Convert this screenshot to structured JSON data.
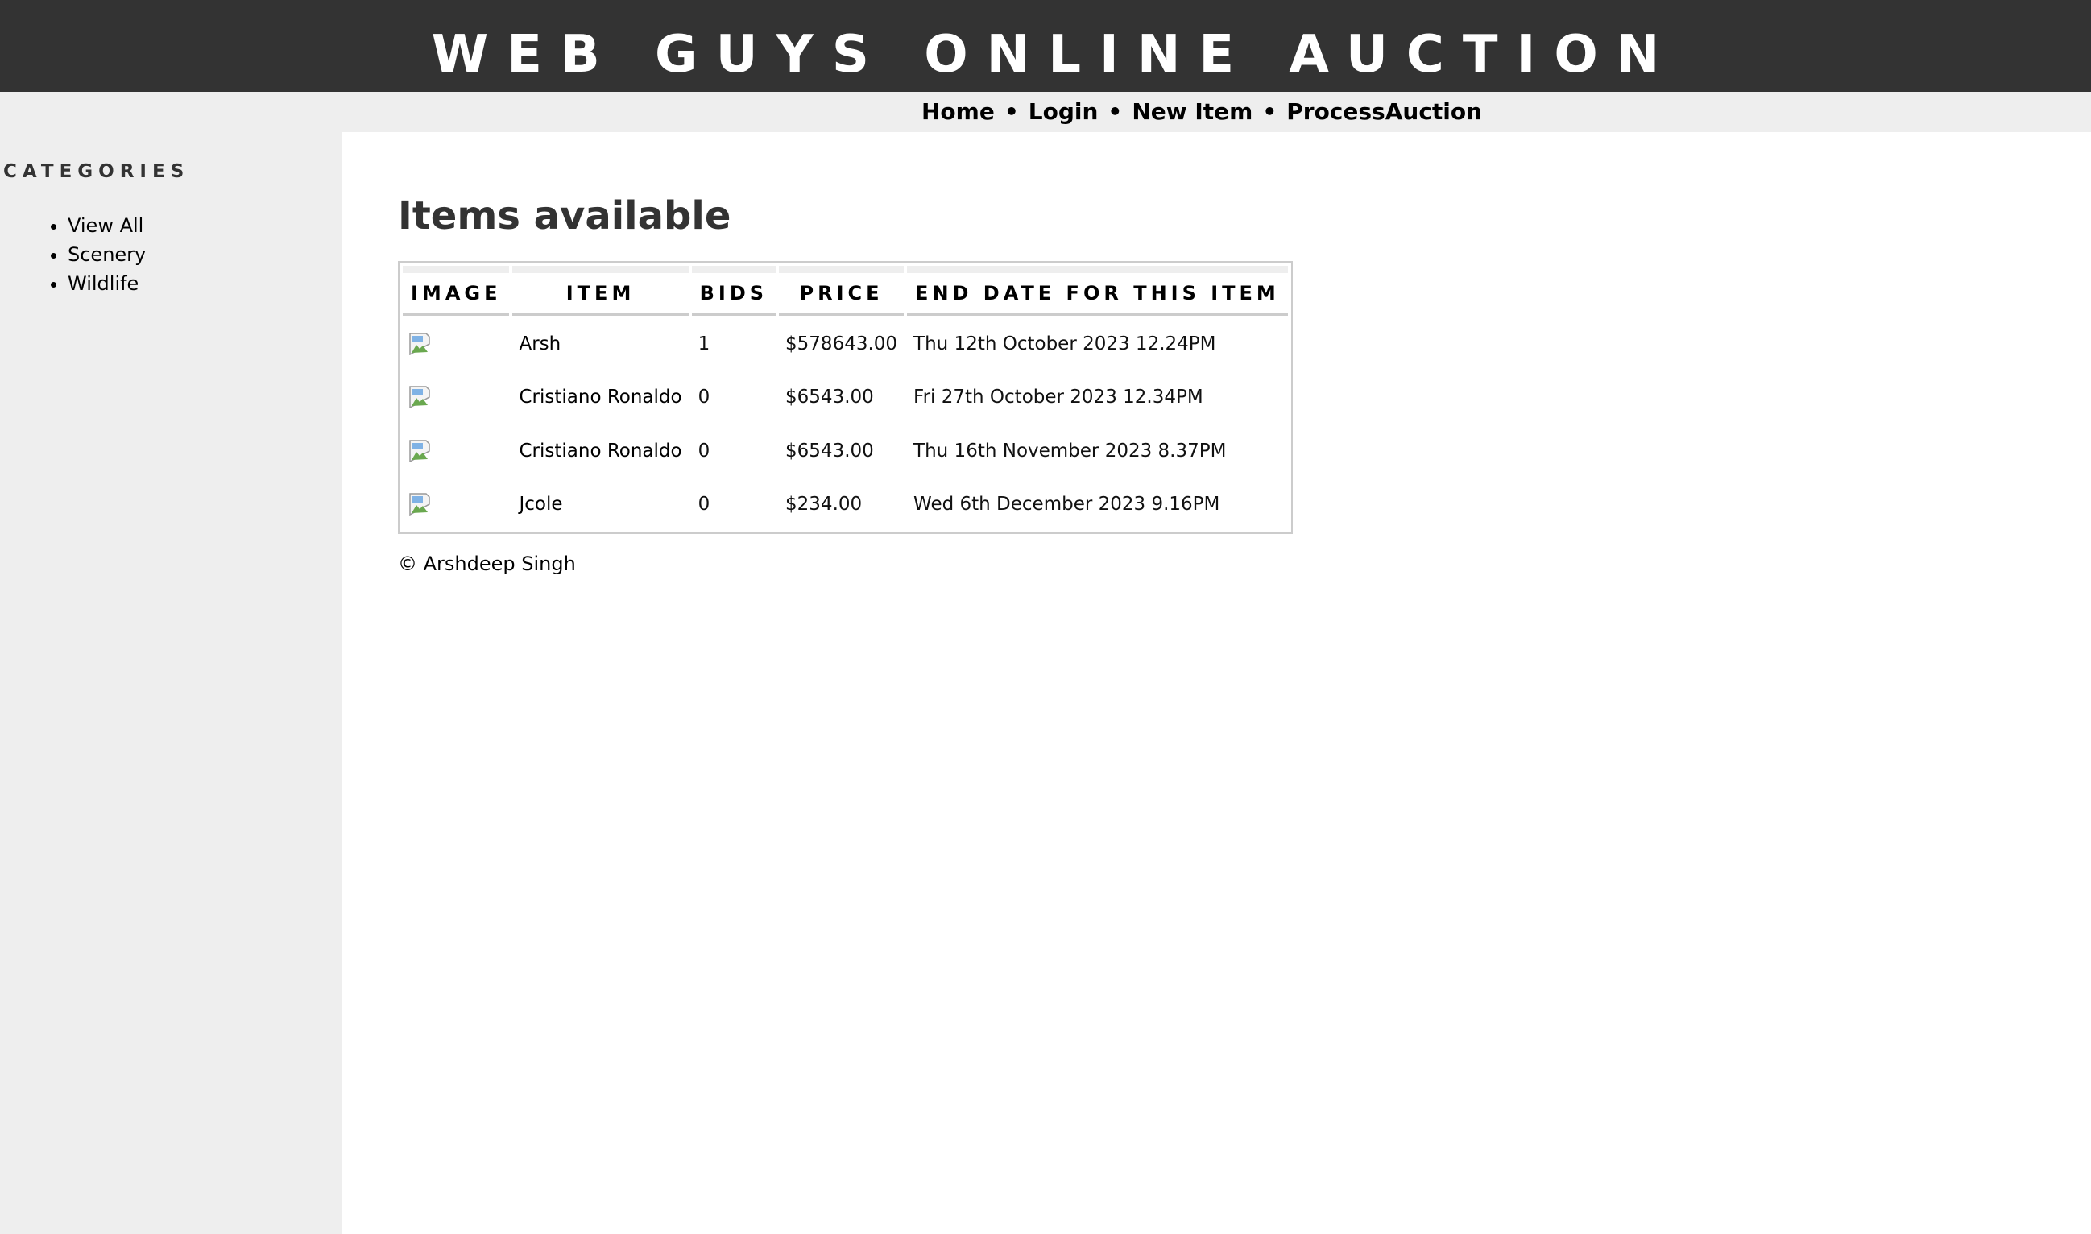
{
  "site": {
    "title": "WEB GUYS ONLINE AUCTION"
  },
  "nav": {
    "items": [
      "Home",
      "Login",
      "New Item",
      "ProcessAuction"
    ],
    "separator": "•"
  },
  "sidebar": {
    "title": "CATEGORIES",
    "items": [
      "View All",
      "Scenery",
      "Wildlife"
    ]
  },
  "main": {
    "title": "Items available",
    "table": {
      "headers": [
        "IMAGE",
        "ITEM",
        "BIDS",
        "PRICE",
        "END DATE FOR THIS ITEM"
      ],
      "rows": [
        {
          "image": "broken-image-icon",
          "item": "Arsh",
          "bids": "1",
          "price": "$578643.00",
          "end_date": "Thu 12th October 2023 12.24PM"
        },
        {
          "image": "broken-image-icon",
          "item": "Cristiano Ronaldo",
          "bids": "0",
          "price": "$6543.00",
          "end_date": "Fri 27th October 2023 12.34PM"
        },
        {
          "image": "broken-image-icon",
          "item": "Cristiano Ronaldo",
          "bids": "0",
          "price": "$6543.00",
          "end_date": "Thu 16th November 2023 8.37PM"
        },
        {
          "image": "broken-image-icon",
          "item": "Jcole",
          "bids": "0",
          "price": "$234.00",
          "end_date": "Wed 6th December 2023 9.16PM"
        }
      ]
    }
  },
  "footer": {
    "copyright": "© Arshdeep Singh"
  },
  "colors": {
    "header_bg": "#333333",
    "sidebar_bg": "#eeeeee",
    "title_text": "#333333"
  }
}
